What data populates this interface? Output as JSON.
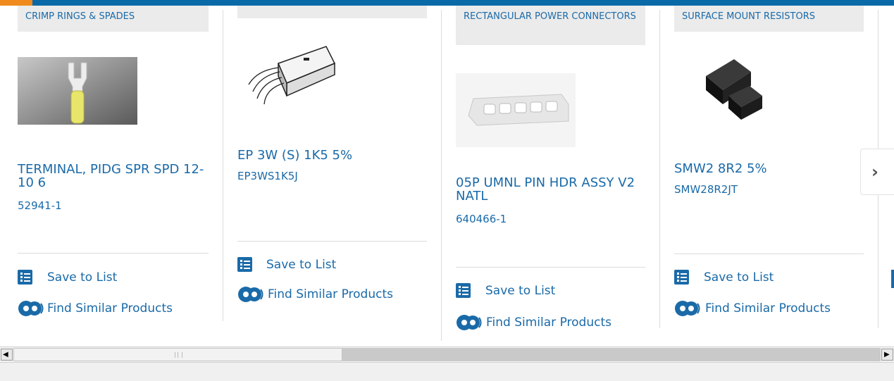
{
  "cards": [
    {
      "category": "CRIMP RINGS & SPADES",
      "name": "TERMINAL, PIDG SPR SPD 12-10 6",
      "part_number": "52941-1",
      "save_label": "Save to List",
      "similar_label": "Find Similar Products"
    },
    {
      "category": "",
      "name": "EP 3W (S) 1K5 5%",
      "part_number": "EP3WS1K5J",
      "save_label": "Save to List",
      "similar_label": "Find Similar Products"
    },
    {
      "category": "RECTANGULAR POWER CONNECTORS",
      "name": "05P UMNL PIN HDR ASSY V2 NATL",
      "part_number": "640466-1",
      "save_label": "Save to List",
      "similar_label": "Find Similar Products"
    },
    {
      "category": "SURFACE MOUNT RESISTORS",
      "name": "SMW2 8R2 5%",
      "part_number": "SMW28R2JT",
      "save_label": "Save to List",
      "similar_label": "Find Similar Products"
    }
  ],
  "next_button_glyph": "›",
  "scroll_left_glyph": "◀",
  "scroll_right_glyph": "▶",
  "colors": {
    "link": "#1a6aa8",
    "topbar": "#0a6aa8",
    "accent": "#f08a1c"
  }
}
